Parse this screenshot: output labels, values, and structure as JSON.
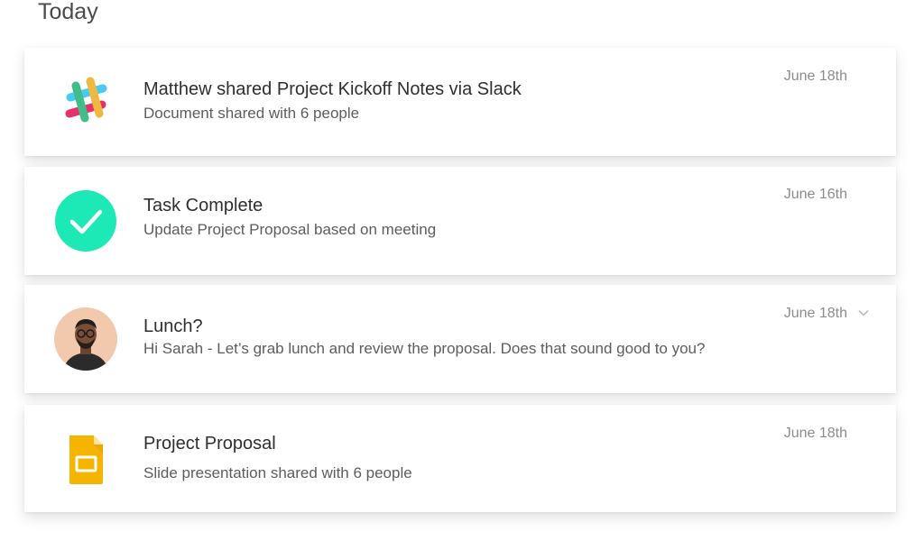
{
  "section": {
    "title": "Today"
  },
  "notifications": [
    {
      "icon": "slack-icon",
      "title": "Matthew shared Project Kickoff Notes via Slack",
      "subtitle": "Document shared with 6 people",
      "date": "June 18th"
    },
    {
      "icon": "check-circle-icon",
      "title": "Task Complete",
      "subtitle": "Update Project Proposal based on meeting",
      "date": "June 16th"
    },
    {
      "icon": "avatar",
      "title": "Lunch?",
      "subtitle": "Hi Sarah - Let’s grab lunch and review the proposal. Does that sound good to you?",
      "date": "June 18th"
    },
    {
      "icon": "google-slides-icon",
      "title": "Project Proposal",
      "subtitle": "Slide presentation shared with 6 people",
      "date": "June 18th"
    }
  ],
  "colors": {
    "check_green": "#1de9b6",
    "slides_yellow": "#f4b400",
    "slack_blue": "#36c5f0",
    "slack_green": "#2eb67d",
    "slack_yellow": "#ecb22e",
    "slack_red": "#e01e5a"
  }
}
